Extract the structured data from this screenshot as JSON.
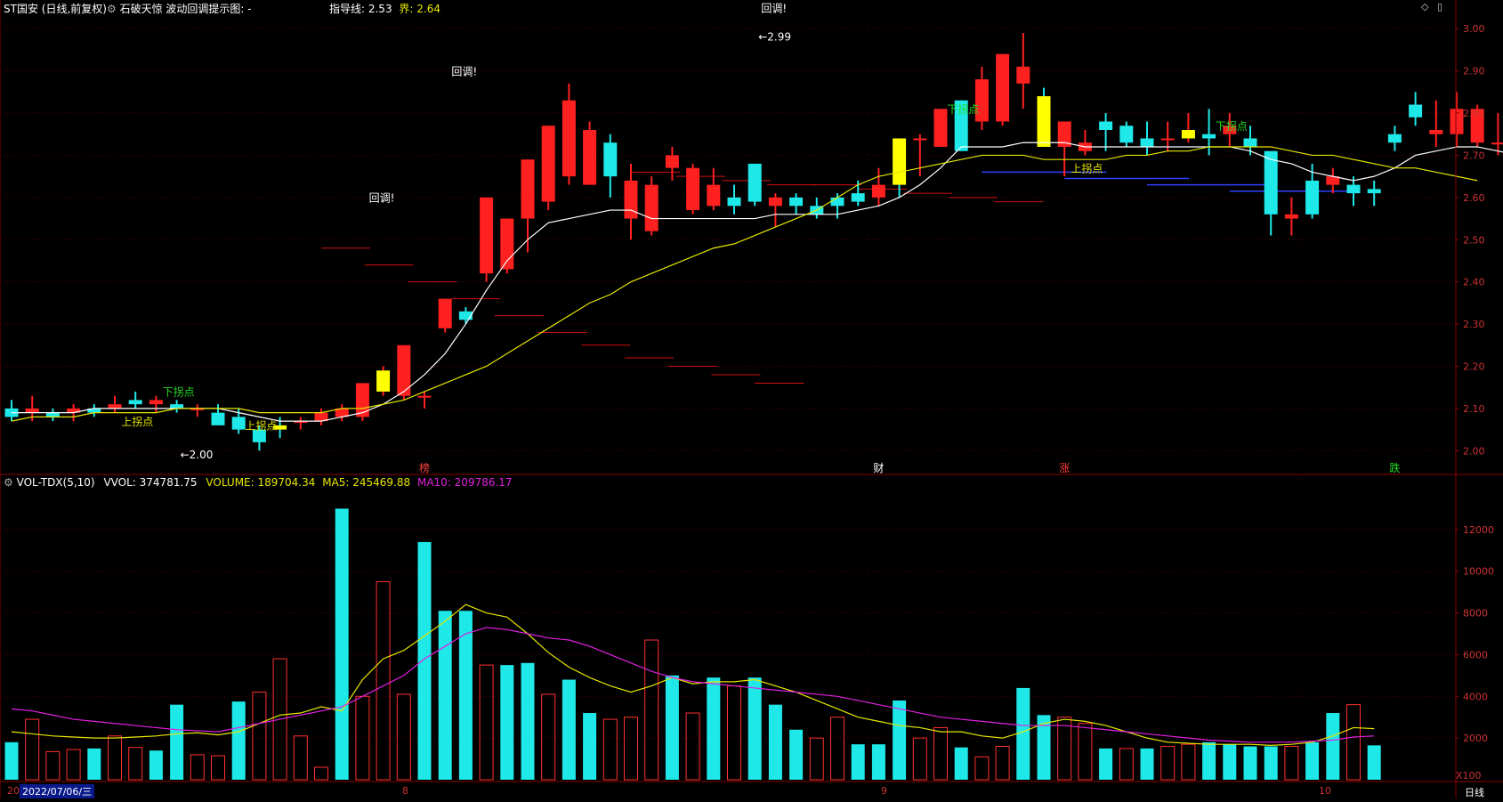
{
  "header": {
    "security": "ST国安 (日线,前复权)",
    "indicator_prefix": "石破天惊  波动回调提示图: -",
    "guide_label": "指导线: 2.53",
    "bound_label": "界: 2.64"
  },
  "volume_header": {
    "name": "VOL-TDX(5,10)",
    "vvol": "VVOL: 374781.75",
    "volume": "VOLUME: 189704.34",
    "ma5": "MA5: 245469.88",
    "ma10": "MA10: 209786.17"
  },
  "controls": {
    "diamond": "◇",
    "window": "▯"
  },
  "unit_label": "X100",
  "bottom": {
    "start_date": "2022/07/06/三",
    "period": "日线",
    "months": [
      "8",
      "9",
      "10"
    ],
    "left_cut": "20"
  },
  "colors": {
    "up": "#ff2020",
    "down": "#1fe8e8",
    "signal": "#ffff00",
    "ma5": "#ffffff",
    "ma10": "#e6e600",
    "vol_ma10": "#e020e0",
    "axis": "#8b0000",
    "text_axis": "#cc3333"
  },
  "chart_data": {
    "type": "candlestick",
    "price_axis": {
      "ylim": [
        1.95,
        3.03
      ],
      "ticks": [
        "3.00",
        "2.90",
        "2.80",
        "2.70",
        "2.60",
        "2.50",
        "2.40",
        "2.30",
        "2.20",
        "2.10",
        "2.00"
      ]
    },
    "volume_axis": {
      "ylim": [
        0,
        14000
      ],
      "ticks": [
        "12000",
        "10000",
        "8000",
        "6000",
        "4000",
        "2000"
      ]
    },
    "candles": [
      [
        2.1,
        2.12,
        2.07,
        2.08
      ],
      [
        2.09,
        2.13,
        2.07,
        2.1
      ],
      [
        2.09,
        2.1,
        2.07,
        2.08
      ],
      [
        2.09,
        2.11,
        2.07,
        2.1
      ],
      [
        2.1,
        2.11,
        2.08,
        2.09
      ],
      [
        2.1,
        2.13,
        2.09,
        2.11
      ],
      [
        2.12,
        2.14,
        2.1,
        2.11
      ],
      [
        2.11,
        2.13,
        2.09,
        2.12
      ],
      [
        2.11,
        2.12,
        2.09,
        2.1
      ],
      [
        2.1,
        2.11,
        2.08,
        2.1
      ],
      [
        2.09,
        2.11,
        2.06,
        2.06
      ],
      [
        2.08,
        2.1,
        2.04,
        2.05
      ],
      [
        2.05,
        2.06,
        2.0,
        2.02
      ],
      [
        2.06,
        2.08,
        2.03,
        2.05
      ],
      [
        2.07,
        2.08,
        2.05,
        2.07
      ],
      [
        2.07,
        2.1,
        2.06,
        2.09
      ],
      [
        2.08,
        2.11,
        2.07,
        2.1
      ],
      [
        2.08,
        2.16,
        2.07,
        2.16
      ],
      [
        2.14,
        2.2,
        2.13,
        2.19
      ],
      [
        2.13,
        2.25,
        2.12,
        2.25
      ],
      [
        2.13,
        2.14,
        2.1,
        2.13
      ],
      [
        2.29,
        2.36,
        2.28,
        2.36
      ],
      [
        2.33,
        2.34,
        2.3,
        2.31
      ],
      [
        2.42,
        2.6,
        2.4,
        2.6
      ],
      [
        2.43,
        2.55,
        2.42,
        2.55
      ],
      [
        2.55,
        2.69,
        2.47,
        2.69
      ],
      [
        2.59,
        2.77,
        2.57,
        2.77
      ],
      [
        2.65,
        2.87,
        2.63,
        2.83
      ],
      [
        2.63,
        2.78,
        2.63,
        2.76
      ],
      [
        2.73,
        2.75,
        2.6,
        2.65
      ],
      [
        2.55,
        2.68,
        2.5,
        2.64
      ],
      [
        2.52,
        2.65,
        2.51,
        2.63
      ],
      [
        2.67,
        2.72,
        2.64,
        2.7
      ],
      [
        2.57,
        2.68,
        2.56,
        2.67
      ],
      [
        2.58,
        2.67,
        2.57,
        2.63
      ],
      [
        2.6,
        2.63,
        2.56,
        2.58
      ],
      [
        2.68,
        2.68,
        2.58,
        2.59
      ],
      [
        2.58,
        2.61,
        2.53,
        2.6
      ],
      [
        2.6,
        2.61,
        2.56,
        2.58
      ],
      [
        2.58,
        2.6,
        2.55,
        2.56
      ],
      [
        2.6,
        2.61,
        2.55,
        2.58
      ],
      [
        2.61,
        2.64,
        2.58,
        2.59
      ],
      [
        2.6,
        2.67,
        2.58,
        2.63
      ],
      [
        2.74,
        2.74,
        2.6,
        2.63
      ],
      [
        2.74,
        2.75,
        2.65,
        2.74
      ],
      [
        2.72,
        2.81,
        2.72,
        2.81
      ],
      [
        2.83,
        2.83,
        2.71,
        2.71
      ],
      [
        2.78,
        2.91,
        2.76,
        2.88
      ],
      [
        2.78,
        2.94,
        2.77,
        2.94
      ],
      [
        2.87,
        2.99,
        2.81,
        2.91
      ],
      [
        2.84,
        2.86,
        2.72,
        2.72
      ],
      [
        2.72,
        2.78,
        2.65,
        2.78
      ],
      [
        2.71,
        2.76,
        2.7,
        2.73
      ],
      [
        2.78,
        2.8,
        2.71,
        2.76
      ],
      [
        2.77,
        2.78,
        2.72,
        2.73
      ],
      [
        2.74,
        2.78,
        2.7,
        2.72
      ],
      [
        2.74,
        2.78,
        2.71,
        2.74
      ],
      [
        2.74,
        2.8,
        2.73,
        2.76
      ],
      [
        2.75,
        2.81,
        2.7,
        2.74
      ],
      [
        2.75,
        2.8,
        2.72,
        2.77
      ],
      [
        2.74,
        2.77,
        2.7,
        2.72
      ],
      [
        2.71,
        2.7,
        2.51,
        2.56
      ],
      [
        2.55,
        2.6,
        2.51,
        2.56
      ],
      [
        2.64,
        2.68,
        2.55,
        2.56
      ],
      [
        2.63,
        2.67,
        2.61,
        2.65
      ],
      [
        2.63,
        2.65,
        2.58,
        2.61
      ],
      [
        2.62,
        2.64,
        2.58,
        2.61
      ],
      [
        2.75,
        2.77,
        2.71,
        2.73
      ],
      [
        2.82,
        2.85,
        2.77,
        2.79
      ],
      [
        2.75,
        2.83,
        2.72,
        2.76
      ],
      [
        2.75,
        2.85,
        2.72,
        2.81
      ],
      [
        2.73,
        2.82,
        2.72,
        2.81
      ],
      [
        2.73,
        2.8,
        2.7,
        2.73
      ],
      [
        2.73,
        2.75,
        2.7,
        2.71
      ],
      [
        2.69,
        2.71,
        2.64,
        2.68
      ],
      [
        2.68,
        2.71,
        2.63,
        2.66
      ],
      [
        2.7,
        2.7,
        2.6,
        2.63
      ],
      [
        2.61,
        2.63,
        2.55,
        2.58
      ],
      [
        2.62,
        2.68,
        2.58,
        2.6
      ],
      [
        2.63,
        2.69,
        2.58,
        2.62
      ],
      [
        2.61,
        2.63,
        2.56,
        2.6
      ],
      [
        2.6,
        2.65,
        2.58,
        2.61
      ],
      [
        2.63,
        2.65,
        2.57,
        2.58
      ],
      [
        2.62,
        2.7,
        2.61,
        2.62
      ],
      [
        2.6,
        2.61,
        2.47,
        2.47
      ],
      [
        2.39,
        2.43,
        2.35,
        2.38
      ],
      [
        2.4,
        2.4,
        2.29,
        2.36
      ]
    ],
    "signal_days": [
      13,
      18,
      43,
      50,
      57,
      78,
      80
    ],
    "ma5": [
      2.09,
      2.09,
      2.09,
      2.09,
      2.1,
      2.1,
      2.1,
      2.1,
      2.1,
      2.1,
      2.1,
      2.09,
      2.08,
      2.07,
      2.07,
      2.07,
      2.08,
      2.09,
      2.11,
      2.14,
      2.18,
      2.23,
      2.3,
      2.38,
      2.45,
      2.5,
      2.54,
      2.55,
      2.56,
      2.57,
      2.57,
      2.55,
      2.55,
      2.55,
      2.55,
      2.55,
      2.55,
      2.56,
      2.56,
      2.56,
      2.56,
      2.57,
      2.58,
      2.6,
      2.63,
      2.67,
      2.72,
      2.72,
      2.72,
      2.73,
      2.73,
      2.73,
      2.72,
      2.72,
      2.72,
      2.72,
      2.72,
      2.72,
      2.72,
      2.72,
      2.71,
      2.69,
      2.68,
      2.66,
      2.65,
      2.64,
      2.65,
      2.67,
      2.7,
      2.71,
      2.72,
      2.72,
      2.71,
      2.7,
      2.7,
      2.68,
      2.67,
      2.66,
      2.64,
      2.63,
      2.62,
      2.62,
      2.61,
      2.58,
      2.53
    ],
    "ma10": [
      2.07,
      2.08,
      2.08,
      2.08,
      2.09,
      2.09,
      2.09,
      2.09,
      2.1,
      2.1,
      2.1,
      2.1,
      2.09,
      2.09,
      2.09,
      2.09,
      2.1,
      2.1,
      2.11,
      2.12,
      2.14,
      2.16,
      2.18,
      2.2,
      2.23,
      2.26,
      2.29,
      2.32,
      2.35,
      2.37,
      2.4,
      2.42,
      2.44,
      2.46,
      2.48,
      2.49,
      2.51,
      2.53,
      2.55,
      2.57,
      2.6,
      2.63,
      2.65,
      2.66,
      2.67,
      2.68,
      2.69,
      2.7,
      2.7,
      2.7,
      2.69,
      2.69,
      2.69,
      2.69,
      2.7,
      2.7,
      2.71,
      2.71,
      2.72,
      2.72,
      2.72,
      2.72,
      2.71,
      2.7,
      2.7,
      2.69,
      2.68,
      2.67,
      2.67,
      2.66,
      2.65,
      2.64
    ],
    "support_levels": [
      2.48,
      2.44,
      2.4,
      2.36,
      2.32,
      2.28,
      2.25,
      2.22,
      2.2,
      2.18,
      2.16
    ],
    "resistance_levels": [
      2.66,
      2.65,
      2.64,
      2.63,
      2.63,
      2.62,
      2.61,
      2.6,
      2.59
    ],
    "volume": [
      1800,
      2900,
      1350,
      1450,
      1500,
      2100,
      1550,
      1400,
      3600,
      1200,
      1150,
      3750,
      4200,
      5800,
      2100,
      600,
      13000,
      4000,
      9500,
      4100,
      11400,
      8100,
      8100,
      5500,
      5500,
      5600,
      4100,
      4800,
      3200,
      2900,
      3000,
      6700,
      5000,
      3200,
      4900,
      4500,
      4900,
      3600,
      2400,
      2000,
      3000,
      1700,
      1700,
      3800,
      2000,
      2500,
      1550,
      1100,
      1600,
      4400,
      3100,
      3000,
      2700,
      1500,
      1500,
      1500,
      1600,
      1700,
      1800,
      1700,
      1600,
      1600,
      1600,
      1800,
      3200,
      3600,
      1650
    ],
    "vol_up": [
      false,
      true,
      true,
      true,
      false,
      true,
      true,
      false,
      false,
      true,
      true,
      false,
      true,
      true,
      true,
      true,
      false,
      true,
      true,
      true,
      false,
      false,
      false,
      true,
      false,
      false,
      true,
      false,
      false,
      true,
      true,
      true,
      false,
      true,
      false,
      true,
      false,
      false,
      false,
      true,
      true,
      false,
      false,
      false,
      true,
      true,
      false,
      true,
      true,
      false,
      false,
      true,
      true,
      false,
      true,
      false,
      true,
      true,
      false,
      false,
      false,
      false,
      true,
      false,
      false,
      true,
      false
    ],
    "vol_ma5": [
      2300,
      2200,
      2100,
      2050,
      2000,
      2000,
      2050,
      2100,
      2200,
      2250,
      2150,
      2300,
      2700,
      3100,
      3200,
      3500,
      3300,
      4800,
      5800,
      6200,
      6900,
      7600,
      8400,
      8000,
      7800,
      7000,
      6100,
      5400,
      4900,
      4500,
      4200,
      4500,
      4900,
      4600,
      4700,
      4700,
      4800,
      4500,
      4200,
      3800,
      3400,
      3000,
      2800,
      2600,
      2500,
      2300,
      2300,
      2100,
      2000,
      2300,
      2700,
      2900,
      2800,
      2600,
      2300,
      2000,
      1800,
      1750,
      1700,
      1700,
      1700,
      1650,
      1700,
      1800,
      2100,
      2500,
      2450
    ],
    "vol_ma10": [
      3400,
      3300,
      3100,
      2900,
      2800,
      2700,
      2600,
      2500,
      2400,
      2350,
      2300,
      2500,
      2700,
      2900,
      3100,
      3300,
      3500,
      4000,
      4500,
      5000,
      5800,
      6400,
      7000,
      7300,
      7200,
      7000,
      6800,
      6700,
      6400,
      6000,
      5600,
      5200,
      4900,
      4700,
      4600,
      4500,
      4400,
      4300,
      4200,
      4100,
      4000,
      3800,
      3600,
      3400,
      3200,
      3000,
      2900,
      2800,
      2700,
      2600,
      2600,
      2600,
      2500,
      2400,
      2300,
      2200,
      2100,
      2000,
      1900,
      1850,
      1800,
      1800,
      1800,
      1850,
      1900,
      2050,
      2100
    ],
    "labels": [
      {
        "text": "下拐点",
        "day": 8,
        "price": 2.13,
        "color": "#22dd22"
      },
      {
        "text": "上拐点",
        "day": 6,
        "price": 2.06,
        "color": "#e6e600"
      },
      {
        "text": "上拐点",
        "day": 12,
        "price": 2.05,
        "color": "#e6e600"
      },
      {
        "text": "回调!",
        "day": 18,
        "price": 2.59,
        "color": "#ffffff"
      },
      {
        "text": "回调!",
        "day": 22,
        "price": 2.89,
        "color": "#ffffff"
      },
      {
        "text": "回调!",
        "day": 37,
        "price": 3.04,
        "color": "#ffffff"
      },
      {
        "text": "下拐点",
        "day": 46,
        "price": 2.8,
        "color": "#22dd22"
      },
      {
        "text": "上拐点",
        "day": 52,
        "price": 2.66,
        "color": "#e6e600"
      },
      {
        "text": "下拐点",
        "day": 59,
        "price": 2.76,
        "color": "#22dd22"
      }
    ],
    "price_marks": [
      {
        "text": "2.99",
        "day": 36,
        "price": 2.98
      },
      {
        "text": "2.00",
        "day": 8,
        "price": 1.99
      }
    ],
    "event_markers": [
      {
        "text": "榜",
        "day": 20,
        "color": "#ff4040"
      },
      {
        "text": "财",
        "day": 42,
        "color": "#ffffff"
      },
      {
        "text": "涨",
        "day": 51,
        "color": "#ff4040"
      },
      {
        "text": "跌",
        "day": 67,
        "color": "#22dd22"
      }
    ]
  }
}
